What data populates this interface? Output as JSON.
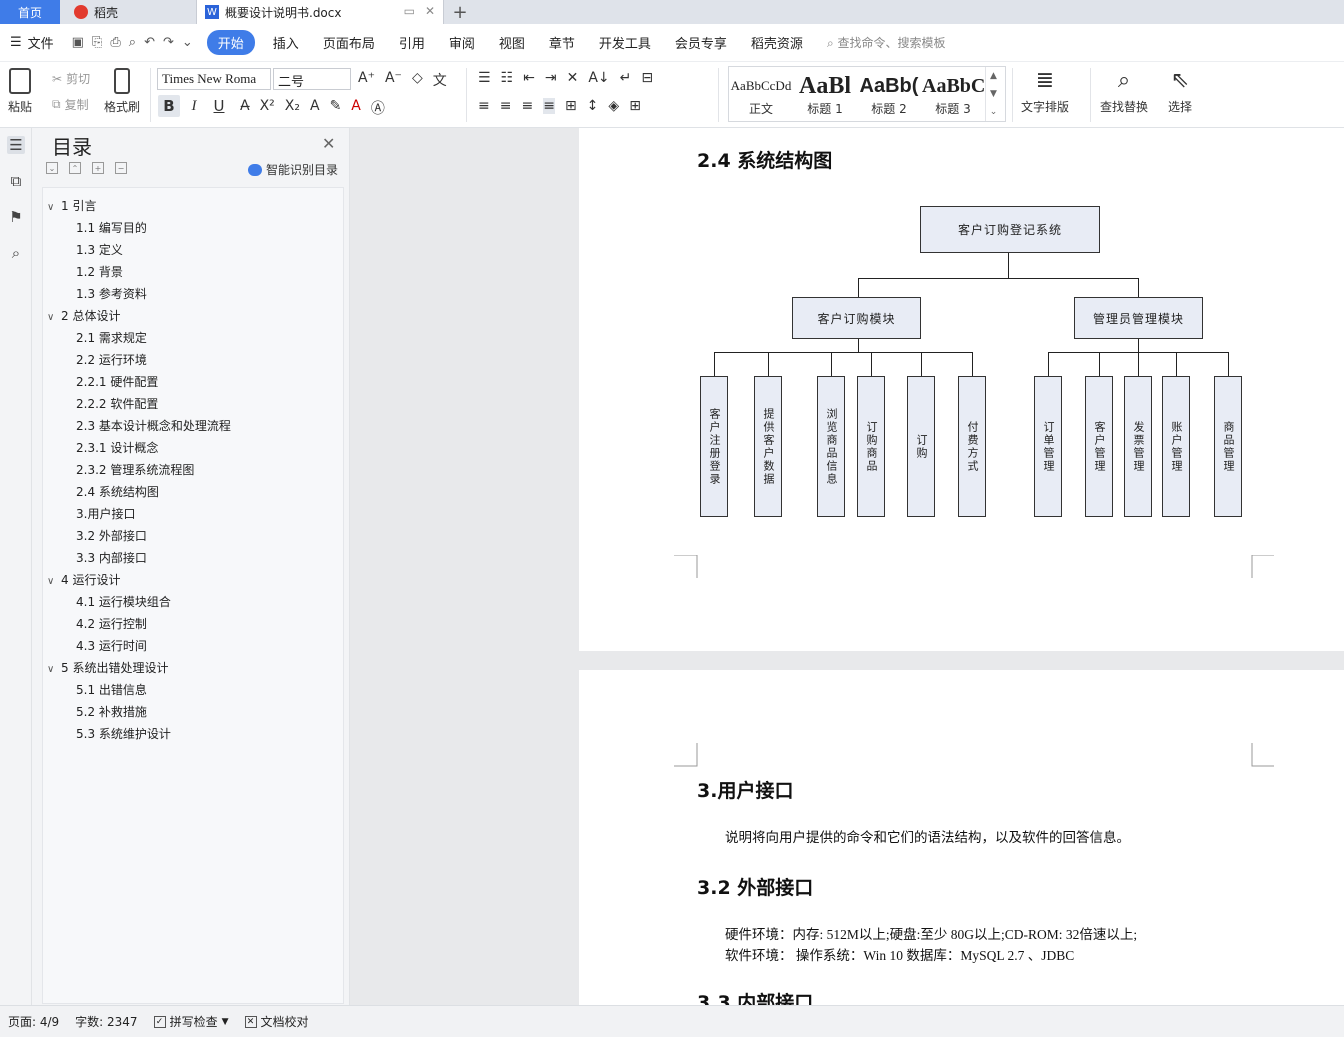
{
  "tabs": {
    "home": "首页",
    "daoke": "稻壳",
    "doc": "概要设计说明书.docx"
  },
  "menu": {
    "file": "文件",
    "items": [
      "开始",
      "插入",
      "页面布局",
      "引用",
      "审阅",
      "视图",
      "章节",
      "开发工具",
      "会员专享",
      "稻壳资源"
    ],
    "active": "开始",
    "search_placeholder": "查找命令、搜索模板"
  },
  "ribbon": {
    "paste": "粘贴",
    "cut": "剪切",
    "copy": "复制",
    "format_painter": "格式刷",
    "font_name": "Times New Roma",
    "font_size": "二号",
    "styles": [
      {
        "preview": "AaBbCcDd",
        "name": "正文"
      },
      {
        "preview": "AaBl",
        "name": "标题 1"
      },
      {
        "preview": "AaBb(",
        "name": "标题 2"
      },
      {
        "preview": "AaBbC",
        "name": "标题 3"
      }
    ],
    "text_layout": "文字排版",
    "find_replace": "查找替换",
    "select": "选择"
  },
  "toc": {
    "title": "目录",
    "smart": "智能识别目录",
    "items": [
      {
        "label": "1 引言",
        "level": 1
      },
      {
        "label": "1.1 编写目的",
        "level": 2
      },
      {
        "label": "1.3 定义",
        "level": 2
      },
      {
        "label": "1.2 背景",
        "level": 2
      },
      {
        "label": "1.3 参考资料",
        "level": 2
      },
      {
        "label": "2 总体设计",
        "level": 1
      },
      {
        "label": "2.1 需求规定",
        "level": 2
      },
      {
        "label": "2.2 运行环境",
        "level": 2
      },
      {
        "label": "2.2.1 硬件配置",
        "level": 2
      },
      {
        "label": "2.2.2  软件配置",
        "level": 2
      },
      {
        "label": "2.3 基本设计概念和处理流程",
        "level": 2
      },
      {
        "label": "2.3.1 设计概念",
        "level": 2
      },
      {
        "label": "2.3.2 管理系统流程图",
        "level": 2
      },
      {
        "label": "2.4 系统结构图",
        "level": 2
      },
      {
        "label": "3.用户接口",
        "level": 2
      },
      {
        "label": "3.2 外部接口",
        "level": 2
      },
      {
        "label": "3.3 内部接口",
        "level": 2
      },
      {
        "label": "4 运行设计",
        "level": 1
      },
      {
        "label": "4.1 运行模块组合",
        "level": 2
      },
      {
        "label": "4.2 运行控制",
        "level": 2
      },
      {
        "label": "4.3 运行时间",
        "level": 2
      },
      {
        "label": "5 系统出错处理设计",
        "level": 1
      },
      {
        "label": "5.1 出错信息",
        "level": 2
      },
      {
        "label": "5.2 补救措施",
        "level": 2
      },
      {
        "label": "5.3 系统维护设计",
        "level": 2
      }
    ]
  },
  "doc": {
    "heading_24": "2.4 系统结构图",
    "diagram": {
      "root": "客户订购登记系统",
      "left": "客户订购模块",
      "right": "管理员管理模块",
      "left_children": [
        "客户注册登录",
        "提供客户数据",
        "浏览商品信息",
        "订购商品",
        "订购",
        "付费方式"
      ],
      "right_children": [
        "订单管理",
        "客户管理",
        "发票管理",
        "账户管理",
        "商品管理"
      ]
    },
    "heading_3": "3.用户接口",
    "para_3": "说明将向用户提供的命令和它们的语法结构，以及软件的回答信息。",
    "heading_32": "3.2 外部接口",
    "hw": "硬件环境：内存: 512M以上;硬盘:至少 80G以上;CD-ROM: 32倍速以上;",
    "sw": "软件环境：  操作系统：Win 10 数据库：MySQL 2.7 、JDBC",
    "heading_33": "3.3 内部接口"
  },
  "status": {
    "page": "页面: 4/9",
    "words": "字数: 2347",
    "spell": "拼写检查",
    "proof": "文档校对"
  },
  "colors": {
    "accent": "#3f7ce8",
    "box_fill": "#e8ecf5"
  }
}
